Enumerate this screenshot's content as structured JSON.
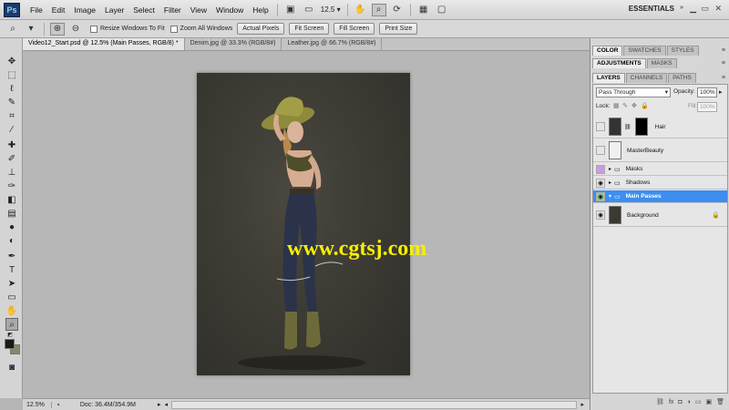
{
  "app": {
    "logo": "Ps"
  },
  "menu": [
    "File",
    "Edit",
    "Image",
    "Layer",
    "Select",
    "Filter",
    "View",
    "Window",
    "Help"
  ],
  "menubar": {
    "zoom_value": "12.5",
    "workspace": "ESSENTIALS"
  },
  "options": {
    "resize_windows": "Resize Windows To Fit",
    "zoom_all": "Zoom All Windows",
    "actual_pixels": "Actual Pixels",
    "fit_screen": "Fit Screen",
    "fill_screen": "Fill Screen",
    "print_size": "Print Size"
  },
  "tabs": [
    {
      "label": "Video12_Start.psd @ 12.5% (Main Passes, RGB/8) *"
    },
    {
      "label": "Denim.jpg @ 33.3% (RGB/8#)"
    },
    {
      "label": "Leather.jpg @ 66.7% (RGB/8#)"
    }
  ],
  "canvas": {
    "watermark": "www.cgtsj.com"
  },
  "status": {
    "zoom": "12.5%",
    "doc": "Doc: 36.4M/354.9M"
  },
  "panels": {
    "top_tabs": [
      "COLOR",
      "SWATCHES",
      "STYLES"
    ],
    "mid_tabs": [
      "ADJUSTMENTS",
      "MASKS"
    ],
    "layer_tabs": [
      "LAYERS",
      "CHANNELS",
      "PATHS"
    ]
  },
  "layers_panel": {
    "blend_mode": "Pass Through",
    "opacity_label": "Opacity:",
    "opacity": "100%",
    "lock_label": "Lock:",
    "fill_label": "Fill:",
    "fill": "100%",
    "layers": [
      {
        "name": "Hair"
      },
      {
        "name": "MasterBeauty"
      },
      {
        "name": "Masks"
      },
      {
        "name": "Shadows"
      },
      {
        "name": "Main Passes"
      },
      {
        "name": "Background"
      }
    ]
  },
  "colors": {
    "accent": "#3c8ef0",
    "watermark": "#f5f000",
    "doc_bg": "#3a3932"
  }
}
